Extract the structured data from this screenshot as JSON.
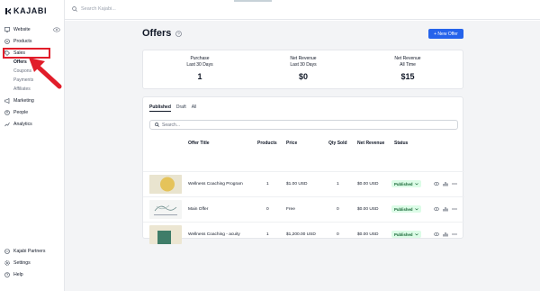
{
  "app": {
    "brand": "KAJABI",
    "search_placeholder": "Search Kajabi..."
  },
  "sidebar": {
    "website": "Website",
    "products": "Products",
    "sales": "Sales",
    "sales_sub": [
      "Offers",
      "Coupons",
      "Payments",
      "Affiliates"
    ],
    "marketing": "Marketing",
    "people": "People",
    "analytics": "Analytics",
    "partners": "Kajabi Partners",
    "settings": "Settings",
    "help": "Help"
  },
  "page": {
    "title": "Offers",
    "new_offer_label": "+ New Offer"
  },
  "stats": [
    {
      "label_line1": "Purchase",
      "label_line2": "Last 30 Days",
      "value": "1"
    },
    {
      "label_line1": "Net Revenue",
      "label_line2": "Last 30 Days",
      "value": "$0"
    },
    {
      "label_line1": "Net Revenue",
      "label_line2": "All Time",
      "value": "$15"
    }
  ],
  "tabs": [
    "Published",
    "Draft",
    "All"
  ],
  "table": {
    "search_placeholder": "Search...",
    "headers": [
      "Offer Title",
      "Products",
      "Price",
      "Qty Sold",
      "Net Revenue",
      "Status"
    ],
    "rows": [
      {
        "title": "Wellness Coaching Program",
        "products": "1",
        "price": "$1.00 USD",
        "qty": "1",
        "revenue": "$0.00 USD",
        "status": "Published"
      },
      {
        "title": "Main Offer",
        "products": "0",
        "price": "Free",
        "qty": "0",
        "revenue": "$0.00 USD",
        "status": "Published"
      },
      {
        "title": "Wellness Coaching - acuity",
        "products": "1",
        "price": "$1,200.00 USD",
        "qty": "0",
        "revenue": "$0.00 USD",
        "status": "Published"
      }
    ]
  },
  "colors": {
    "accent": "#2563eb",
    "highlight": "#e11d2a",
    "published_bg": "#dcfce7",
    "published_text": "#166534"
  },
  "icons": [
    "monitor-icon",
    "products-icon",
    "tag-icon",
    "eye-icon",
    "megaphone-icon",
    "people-icon",
    "analytics-icon",
    "partners-icon",
    "gear-icon",
    "help-icon",
    "search-icon",
    "question-icon",
    "chart-icon",
    "more-icon",
    "chevron-down-icon"
  ]
}
